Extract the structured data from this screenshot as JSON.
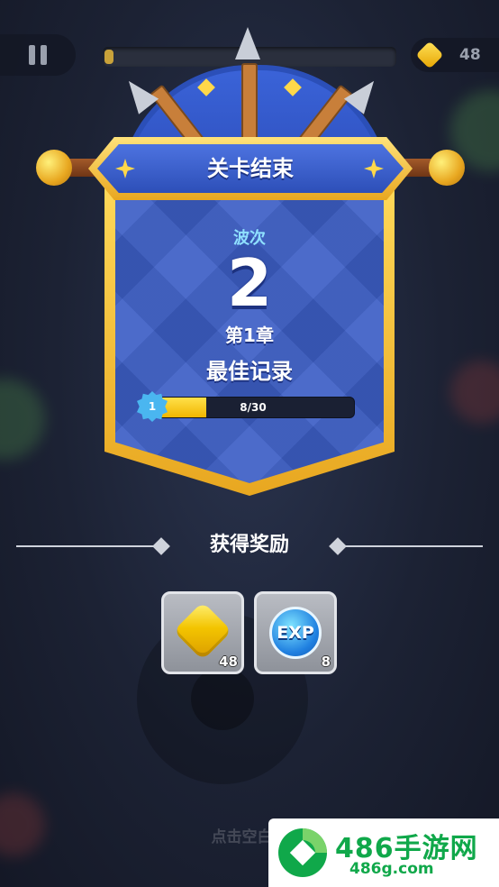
{
  "hud": {
    "coin_count": "48",
    "progress_fraction": 0.03
  },
  "result": {
    "title": "关卡结束",
    "wave_label": "波次",
    "wave_number": "2",
    "chapter": "第1章",
    "best_record": "最佳记录",
    "level": "1",
    "xp_text": "8/30",
    "xp_fraction": 0.27
  },
  "rewards": {
    "title": "获得奖励",
    "items": [
      {
        "icon": "gold-coin-icon",
        "count": "48"
      },
      {
        "icon": "exp-orb-icon",
        "label": "EXP",
        "count": "8"
      }
    ]
  },
  "hint": "点击空白处",
  "watermark": {
    "title": "486手游网",
    "url": "486g.com"
  },
  "colors": {
    "shield_blue": "#3d5fc6",
    "gold_frame": "#e8a720",
    "xp_fill": "#f1b600",
    "brand_green": "#10a84a"
  }
}
